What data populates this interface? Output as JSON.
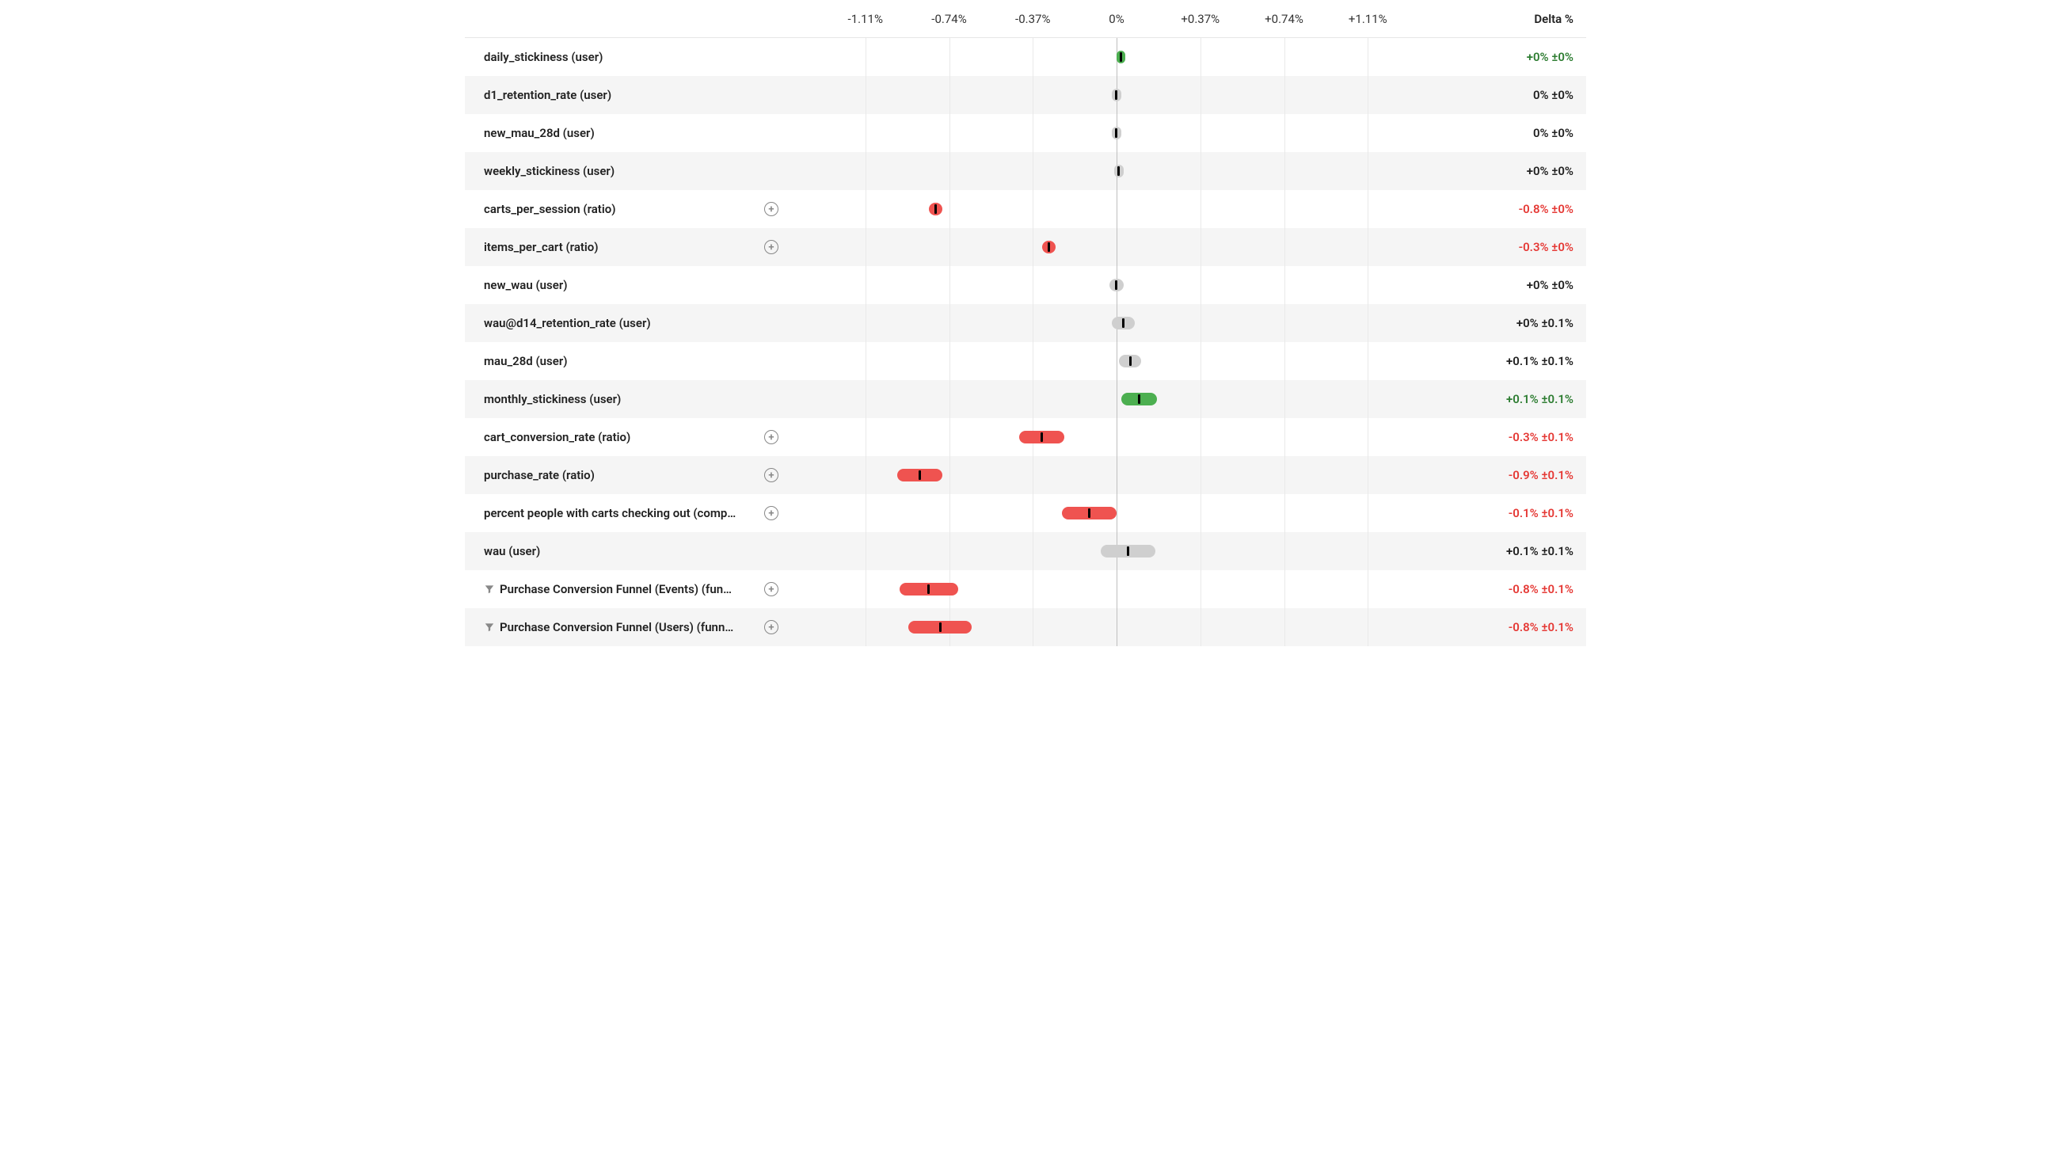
{
  "axis": {
    "min": -1.48,
    "max": 1.48,
    "ticks": [
      -1.11,
      -0.74,
      -0.37,
      0,
      0.37,
      0.74,
      1.11
    ],
    "tick_labels": [
      "-1.11%",
      "-0.74%",
      "-0.37%",
      "0%",
      "+0.37%",
      "+0.74%",
      "+1.11%"
    ],
    "delta_header": "Delta %"
  },
  "metrics": [
    {
      "label": "daily_stickiness (user)",
      "has_filter": false,
      "has_plus": false,
      "color": "green",
      "point": 0.02,
      "ci": 0.02,
      "delta_text": "+0% ±0%",
      "delta_color": "green"
    },
    {
      "label": "d1_retention_rate (user)",
      "has_filter": false,
      "has_plus": false,
      "color": "gray",
      "point": 0.0,
      "ci": 0.02,
      "delta_text": "0% ±0%",
      "delta_color": "black"
    },
    {
      "label": "new_mau_28d (user)",
      "has_filter": false,
      "has_plus": false,
      "color": "gray",
      "point": 0.0,
      "ci": 0.02,
      "delta_text": "0% ±0%",
      "delta_color": "black"
    },
    {
      "label": "weekly_stickiness (user)",
      "has_filter": false,
      "has_plus": false,
      "color": "gray",
      "point": 0.01,
      "ci": 0.02,
      "delta_text": "+0% ±0%",
      "delta_color": "black"
    },
    {
      "label": "carts_per_session (ratio)",
      "has_filter": false,
      "has_plus": true,
      "color": "red",
      "point": -0.8,
      "ci": 0.03,
      "delta_text": "-0.8% ±0%",
      "delta_color": "red"
    },
    {
      "label": "items_per_cart (ratio)",
      "has_filter": false,
      "has_plus": true,
      "color": "red",
      "point": -0.3,
      "ci": 0.03,
      "delta_text": "-0.3% ±0%",
      "delta_color": "red"
    },
    {
      "label": "new_wau (user)",
      "has_filter": false,
      "has_plus": false,
      "color": "gray",
      "point": 0.0,
      "ci": 0.03,
      "delta_text": "+0% ±0%",
      "delta_color": "black"
    },
    {
      "label": "wau@d14_retention_rate (user)",
      "has_filter": false,
      "has_plus": false,
      "color": "gray",
      "point": 0.03,
      "ci": 0.05,
      "delta_text": "+0% ±0.1%",
      "delta_color": "black"
    },
    {
      "label": "mau_28d (user)",
      "has_filter": false,
      "has_plus": false,
      "color": "gray",
      "point": 0.06,
      "ci": 0.05,
      "delta_text": "+0.1% ±0.1%",
      "delta_color": "black"
    },
    {
      "label": "monthly_stickiness (user)",
      "has_filter": false,
      "has_plus": false,
      "color": "green",
      "point": 0.1,
      "ci": 0.08,
      "delta_text": "+0.1% ±0.1%",
      "delta_color": "green"
    },
    {
      "label": "cart_conversion_rate (ratio)",
      "has_filter": false,
      "has_plus": true,
      "color": "red",
      "point": -0.33,
      "ci": 0.1,
      "delta_text": "-0.3% ±0.1%",
      "delta_color": "red"
    },
    {
      "label": "purchase_rate (ratio)",
      "has_filter": false,
      "has_plus": true,
      "color": "red",
      "point": -0.87,
      "ci": 0.1,
      "delta_text": "-0.9% ±0.1%",
      "delta_color": "red"
    },
    {
      "label": "percent people with carts checking out (comp…",
      "has_filter": false,
      "has_plus": true,
      "color": "red",
      "point": -0.12,
      "ci": 0.12,
      "delta_text": "-0.1% ±0.1%",
      "delta_color": "red"
    },
    {
      "label": "wau (user)",
      "has_filter": false,
      "has_plus": false,
      "color": "gray",
      "point": 0.05,
      "ci": 0.12,
      "delta_text": "+0.1% ±0.1%",
      "delta_color": "black"
    },
    {
      "label": "Purchase Conversion Funnel (Events) (fun…",
      "has_filter": true,
      "has_plus": true,
      "color": "red",
      "point": -0.83,
      "ci": 0.13,
      "delta_text": "-0.8% ±0.1%",
      "delta_color": "red"
    },
    {
      "label": "Purchase Conversion Funnel (Users) (funn…",
      "has_filter": true,
      "has_plus": true,
      "color": "red",
      "point": -0.78,
      "ci": 0.14,
      "delta_text": "-0.8% ±0.1%",
      "delta_color": "red"
    }
  ],
  "chart_data": {
    "type": "scatter",
    "title": "",
    "xlabel": "Delta %",
    "ylabel": "",
    "xlim": [
      -1.48,
      1.48
    ],
    "series": [
      {
        "name": "daily_stickiness (user)",
        "point": 0.02,
        "ci": 0.02,
        "significance": "positive"
      },
      {
        "name": "d1_retention_rate (user)",
        "point": 0.0,
        "ci": 0.02,
        "significance": "neutral"
      },
      {
        "name": "new_mau_28d (user)",
        "point": 0.0,
        "ci": 0.02,
        "significance": "neutral"
      },
      {
        "name": "weekly_stickiness (user)",
        "point": 0.01,
        "ci": 0.02,
        "significance": "neutral"
      },
      {
        "name": "carts_per_session (ratio)",
        "point": -0.8,
        "ci": 0.03,
        "significance": "negative"
      },
      {
        "name": "items_per_cart (ratio)",
        "point": -0.3,
        "ci": 0.03,
        "significance": "negative"
      },
      {
        "name": "new_wau (user)",
        "point": 0.0,
        "ci": 0.03,
        "significance": "neutral"
      },
      {
        "name": "wau@d14_retention_rate (user)",
        "point": 0.03,
        "ci": 0.05,
        "significance": "neutral"
      },
      {
        "name": "mau_28d (user)",
        "point": 0.06,
        "ci": 0.05,
        "significance": "neutral"
      },
      {
        "name": "monthly_stickiness (user)",
        "point": 0.1,
        "ci": 0.08,
        "significance": "positive"
      },
      {
        "name": "cart_conversion_rate (ratio)",
        "point": -0.33,
        "ci": 0.1,
        "significance": "negative"
      },
      {
        "name": "purchase_rate (ratio)",
        "point": -0.87,
        "ci": 0.1,
        "significance": "negative"
      },
      {
        "name": "percent people with carts checking out (composite)",
        "point": -0.12,
        "ci": 0.12,
        "significance": "negative"
      },
      {
        "name": "wau (user)",
        "point": 0.05,
        "ci": 0.12,
        "significance": "neutral"
      },
      {
        "name": "Purchase Conversion Funnel (Events) (funnel)",
        "point": -0.83,
        "ci": 0.13,
        "significance": "negative"
      },
      {
        "name": "Purchase Conversion Funnel (Users) (funnel)",
        "point": -0.78,
        "ci": 0.14,
        "significance": "negative"
      }
    ]
  }
}
